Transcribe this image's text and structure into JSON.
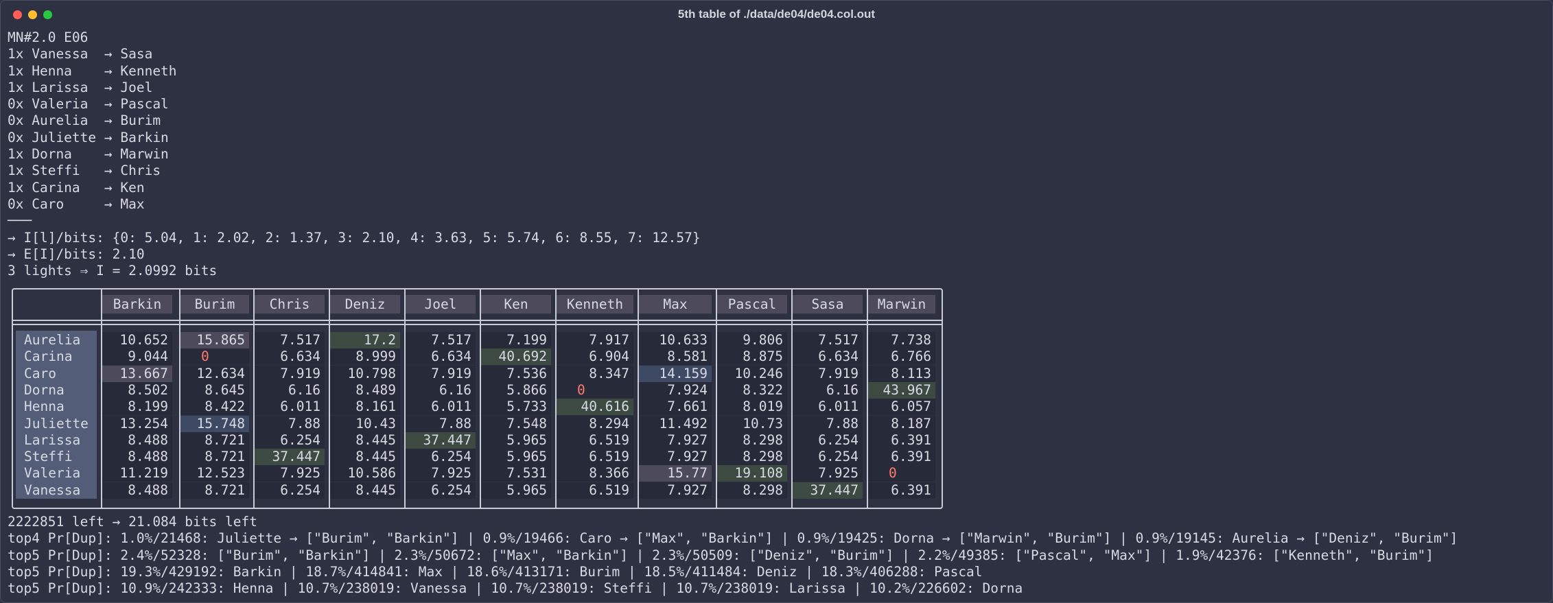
{
  "window": {
    "title": "5th table of ./data/de04/de04.col.out"
  },
  "header_lines": [
    "MN#2.0 E06",
    "1x Vanessa  → Sasa",
    "1x Henna    → Kenneth",
    "1x Larissa  → Joel",
    "0x Valeria  → Pascal",
    "0x Aurelia  → Burim",
    "0x Juliette → Barkin",
    "1x Dorna    → Marwin",
    "1x Steffi   → Chris",
    "1x Carina   → Ken",
    "0x Caro     → Max",
    "───",
    "→ I[l]/bits: {0: 5.04, 1: 2.02, 2: 1.37, 3: 2.10, 4: 3.63, 5: 5.74, 6: 8.55, 7: 12.57}",
    "→ E[I]/bits: 2.10",
    "3 lights ⇒ I = 2.0992 bits"
  ],
  "table": {
    "columns": [
      "Barkin",
      "Burim",
      "Chris",
      "Deniz",
      "Joel",
      "Ken",
      "Kenneth",
      "Max",
      "Pascal",
      "Sasa",
      "Marwin"
    ],
    "rows": [
      {
        "name": "Aurelia",
        "values": [
          "10.652",
          "15.865",
          "7.517",
          "17.2",
          "7.517",
          "7.199",
          "7.917",
          "10.633",
          "9.806",
          "7.517",
          "7.738"
        ]
      },
      {
        "name": "Carina",
        "values": [
          "9.044",
          "0",
          "6.634",
          "8.999",
          "6.634",
          "40.692",
          "6.904",
          "8.581",
          "8.875",
          "6.634",
          "6.766"
        ]
      },
      {
        "name": "Caro",
        "values": [
          "13.667",
          "12.634",
          "7.919",
          "10.798",
          "7.919",
          "7.536",
          "8.347",
          "14.159",
          "10.246",
          "7.919",
          "8.113"
        ]
      },
      {
        "name": "Dorna",
        "values": [
          "8.502",
          "8.645",
          "6.16",
          "8.489",
          "6.16",
          "5.866",
          "0",
          "7.924",
          "8.322",
          "6.16",
          "43.967"
        ]
      },
      {
        "name": "Henna",
        "values": [
          "8.199",
          "8.422",
          "6.011",
          "8.161",
          "6.011",
          "5.733",
          "40.616",
          "7.661",
          "8.019",
          "6.011",
          "6.057"
        ]
      },
      {
        "name": "Juliette",
        "values": [
          "13.254",
          "15.748",
          "7.88",
          "10.43",
          "7.88",
          "7.548",
          "8.294",
          "11.492",
          "10.73",
          "7.88",
          "8.187"
        ]
      },
      {
        "name": "Larissa",
        "values": [
          "8.488",
          "8.721",
          "6.254",
          "8.445",
          "37.447",
          "5.965",
          "6.519",
          "7.927",
          "8.298",
          "6.254",
          "6.391"
        ]
      },
      {
        "name": "Steffi",
        "values": [
          "8.488",
          "8.721",
          "37.447",
          "8.445",
          "6.254",
          "5.965",
          "6.519",
          "7.927",
          "8.298",
          "6.254",
          "6.391"
        ]
      },
      {
        "name": "Valeria",
        "values": [
          "11.219",
          "12.523",
          "7.925",
          "10.586",
          "7.925",
          "7.531",
          "8.366",
          "15.77",
          "19.108",
          "7.925",
          "0"
        ]
      },
      {
        "name": "Vanessa",
        "values": [
          "8.488",
          "8.721",
          "6.254",
          "8.445",
          "6.254",
          "5.965",
          "6.519",
          "7.927",
          "8.298",
          "37.447",
          "6.391"
        ]
      }
    ],
    "highlights": [
      {
        "row": 0,
        "col": 1,
        "color": "#4d4a5c"
      },
      {
        "row": 0,
        "col": 3,
        "color": "#3c4a41"
      },
      {
        "row": 1,
        "col": 5,
        "color": "#3c4a41"
      },
      {
        "row": 2,
        "col": 0,
        "color": "#4d4a5c"
      },
      {
        "row": 2,
        "col": 7,
        "color": "#3e4a63"
      },
      {
        "row": 3,
        "col": 10,
        "color": "#3c4a41"
      },
      {
        "row": 4,
        "col": 6,
        "color": "#3c4a41"
      },
      {
        "row": 5,
        "col": 1,
        "color": "#3e4a63"
      },
      {
        "row": 6,
        "col": 4,
        "color": "#3c4a41"
      },
      {
        "row": 7,
        "col": 2,
        "color": "#3c4a41"
      },
      {
        "row": 8,
        "col": 7,
        "color": "#4d4a5c"
      },
      {
        "row": 8,
        "col": 8,
        "color": "#3c4a41"
      },
      {
        "row": 9,
        "col": 9,
        "color": "#3c4a41"
      }
    ],
    "zero_color": "#ff7a6e"
  },
  "footer_lines": [
    "2222851 left → 21.084 bits left",
    "top4 Pr[Dup]: 1.0%/21468: Juliette → [\"Burim\", \"Barkin\"] | 0.9%/19466: Caro → [\"Max\", \"Barkin\"] | 0.9%/19425: Dorna → [\"Marwin\", \"Burim\"] | 0.9%/19145: Aurelia → [\"Deniz\", \"Burim\"]",
    "top5 Pr[Dup]: 2.4%/52328: [\"Burim\", \"Barkin\"] | 2.3%/50672: [\"Max\", \"Barkin\"] | 2.3%/50509: [\"Deniz\", \"Burim\"] | 2.2%/49385: [\"Pascal\", \"Max\"] | 1.9%/42376: [\"Kenneth\", \"Burim\"]",
    "top5 Pr[Dup]: 19.3%/429192: Barkin | 18.7%/414841: Max | 18.6%/413171: Burim | 18.5%/411484: Deniz | 18.3%/406288: Pascal",
    "top5 Pr[Dup]: 10.9%/242333: Henna | 10.7%/238019: Vanessa | 10.7%/238019: Steffi | 10.7%/238019: Larissa | 10.2%/226602: Dorna"
  ]
}
